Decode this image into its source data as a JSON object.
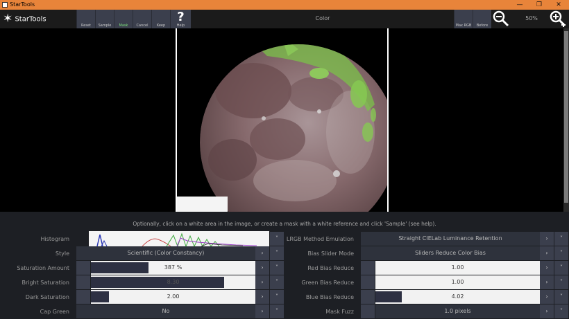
{
  "window": {
    "title": "StarTools",
    "minimize": "—",
    "maximize": "❐",
    "close": "✕"
  },
  "toolbar": {
    "logo_text": "StarTools",
    "buttons": [
      {
        "label": "Reset"
      },
      {
        "label": "Sample"
      },
      {
        "label": "Mask"
      },
      {
        "label": "Cancel"
      },
      {
        "label": "Keep"
      },
      {
        "label": "Help",
        "glyph": "?"
      }
    ],
    "module_title": "Color",
    "right_buttons": [
      {
        "label": "Max RGB"
      },
      {
        "label": "Before"
      }
    ],
    "zoom_level": "50%",
    "zoom_out_icon": "magnifier-minus-icon",
    "zoom_in_icon": "magnifier-plus-icon"
  },
  "hint": "Optionally, click on a white area in the image, or create a mask with a white reference and click 'Sample' (see help).",
  "left_params": [
    {
      "label": "Histogram",
      "type": "histogram"
    },
    {
      "label": "Style",
      "value": "Scientific (Color Constancy)",
      "type": "dropdown"
    },
    {
      "label": "Saturation Amount",
      "value": "387 %",
      "fill": 0.35,
      "type": "slider"
    },
    {
      "label": "Bright Saturation",
      "value": "8.30",
      "fill": 0.81,
      "type": "slider"
    },
    {
      "label": "Dark Saturation",
      "value": "2.00",
      "fill": 0.11,
      "type": "slider"
    },
    {
      "label": "Cap Green",
      "value": "No",
      "type": "dropdown"
    }
  ],
  "right_params": [
    {
      "label": "LRGB Method Emulation",
      "value": "Straight CIELab Luminance Retention",
      "type": "dropdown"
    },
    {
      "label": "Bias Slider Mode",
      "value": "Sliders Reduce Color Bias",
      "type": "dropdown"
    },
    {
      "label": "Red Bias Reduce",
      "value": "1.00",
      "fill": 0.0,
      "type": "slider"
    },
    {
      "label": "Green Bias Reduce",
      "value": "1.00",
      "fill": 0.0,
      "type": "slider"
    },
    {
      "label": "Blue Bias Reduce",
      "value": "4.02",
      "fill": 0.16,
      "type": "slider"
    },
    {
      "label": "Mask Fuzz",
      "value": "1.0 pixels",
      "type": "dropdown"
    }
  ],
  "arrow_glyphs": {
    "right": "›",
    "down": "˅",
    "left": "‹"
  },
  "colors": {
    "titlebar": "#e8843a",
    "button": "#3b3f4d",
    "panel": "#1d1f24",
    "mask_highlight": "#7be07b"
  }
}
